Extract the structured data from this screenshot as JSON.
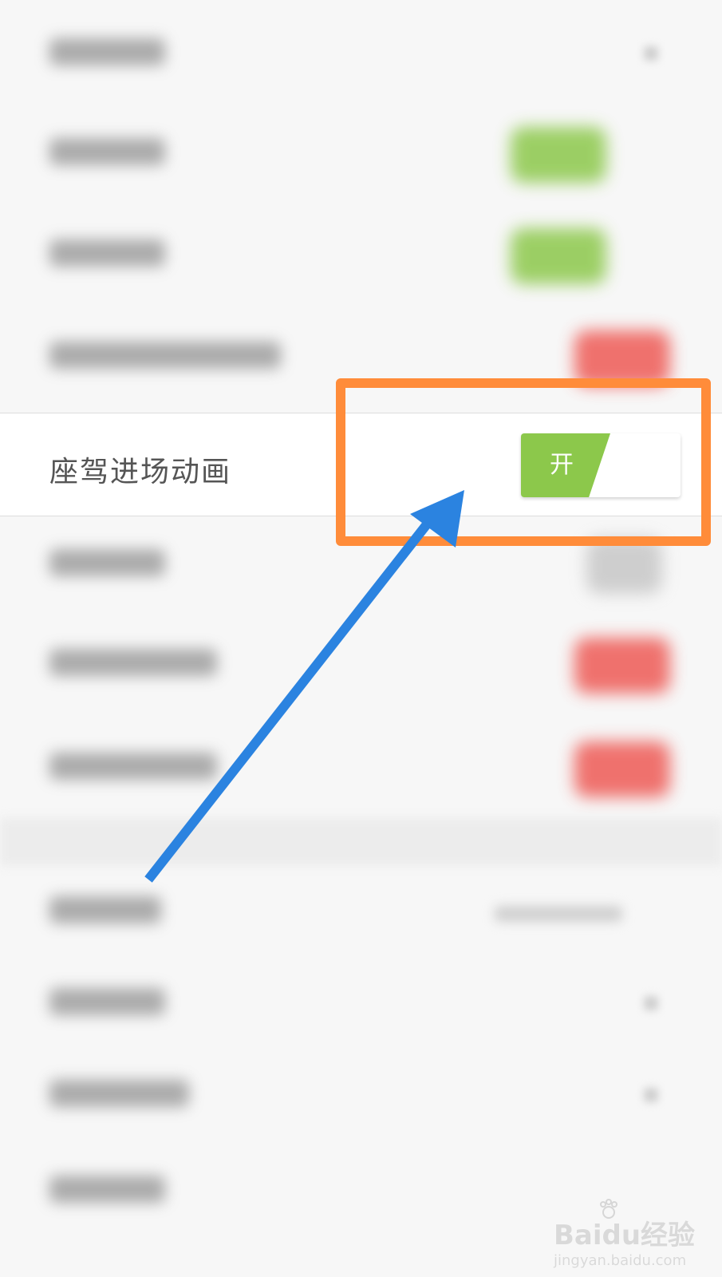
{
  "settings": {
    "highlighted_row": {
      "label": "座驾进场动画",
      "toggle_text": "开",
      "toggle_on": true
    },
    "obscured_rows_above": 4,
    "obscured_rows_below": 7
  },
  "annotation": {
    "box_color": "#ff8c3a",
    "arrow_color": "#2b83e0"
  },
  "colors": {
    "toggle_on": "#8cc84b",
    "toggle_off_red": "#ee5a55",
    "label": "#555555"
  },
  "watermark": {
    "brand": "Baidu经验",
    "url": "jingyan.baidu.com"
  }
}
